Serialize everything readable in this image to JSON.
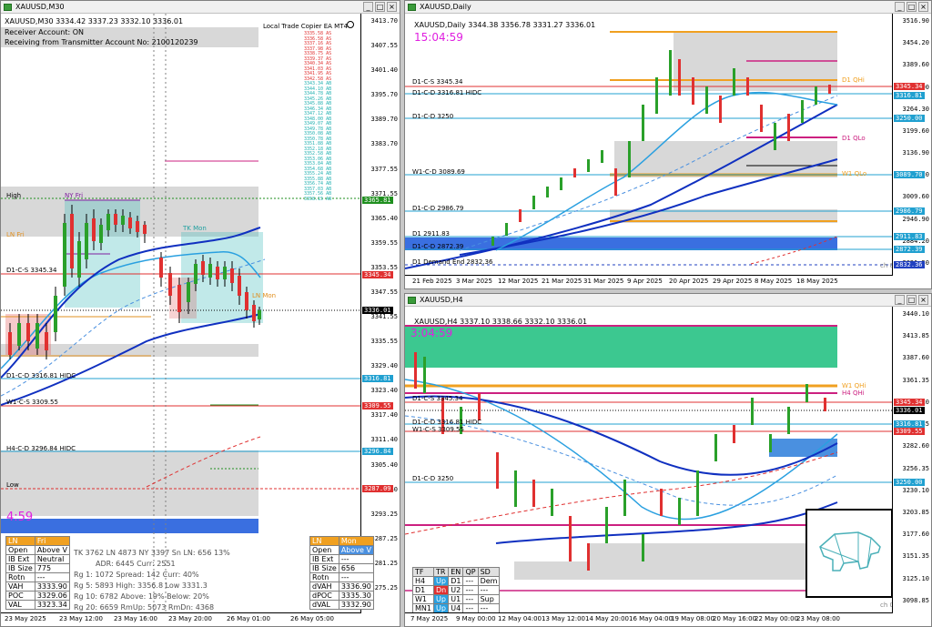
{
  "windows": {
    "m30": {
      "title": "XAUUSD,M30",
      "info_line": "XAUUSD,M30  3334.42 3337.23 3332.10 3336.01",
      "overlay_lines": [
        "Receiver Account: ON",
        "Receiving from Transmitter Account No: 2100120239"
      ],
      "ea_label": "Local Trade Copier EA MT4",
      "timer": "4:59",
      "price_axis": [
        "3413.70",
        "3407.55",
        "3401.40",
        "3395.70",
        "3389.70",
        "3383.70",
        "3377.55",
        "3371.55",
        "3365.40",
        "3359.55",
        "3353.55",
        "3347.55",
        "3341.55",
        "3335.55",
        "3329.40",
        "3323.40",
        "3317.40",
        "3311.40",
        "3305.40",
        "3299.40",
        "3293.25",
        "3287.25",
        "3281.25",
        "3275.25"
      ],
      "price_tags": [
        {
          "text": "3365.81",
          "color": "#1f8f1f"
        },
        {
          "text": "3345.34",
          "color": "#e03030"
        },
        {
          "text": "3336.01",
          "color": "#000000"
        },
        {
          "text": "3316.81",
          "color": "#20a0d0"
        },
        {
          "text": "3309.55",
          "color": "#e03030"
        },
        {
          "text": "3296.84",
          "color": "#20a0d0"
        },
        {
          "text": "3287.09",
          "color": "#e03030"
        }
      ],
      "level_labels": [
        "High",
        "NY Fri",
        "LN Fri",
        "TK Mon",
        "LN Mon",
        "D1-C-S 3345.34",
        "D1-C-D 3316.81 HIDC",
        "W1-C-S 3309.55",
        "H4-C-D 3296.84 HIDC",
        "Low"
      ],
      "time_axis": [
        "23 May 2025",
        "23 May 12:00",
        "23 May 16:00",
        "23 May 20:00",
        "26 May 01:00",
        "26 May 05:00"
      ],
      "ladder": [
        "3335.58",
        "3336.58",
        "3337.16",
        "3337.98",
        "3338.75",
        "3339.37",
        "3340.34",
        "3341.03",
        "3341.95",
        "3342.58",
        "3343.34",
        "3344.10",
        "3344.78",
        "3345.26",
        "3345.88",
        "3346.34",
        "3347.12",
        "3348.00",
        "3349.07",
        "3349.78",
        "3350.08",
        "3350.78",
        "3351.88",
        "3352.18",
        "3352.58",
        "3353.06",
        "3353.84",
        "3354.68",
        "3355.24",
        "3355.88",
        "3356.74",
        "3357.03",
        "3357.56",
        "3358.15"
      ],
      "ladder_tags": [
        "AS",
        "AS",
        "AS",
        "AS",
        "AS",
        "AS",
        "AS",
        "AS",
        "AS",
        "AS",
        "AB",
        "AB",
        "AB",
        "AB",
        "AB",
        "AB",
        "AB",
        "AB",
        "AB",
        "AB",
        "AB",
        "AB",
        "AB",
        "AB",
        "AB",
        "AB",
        "AB",
        "AB",
        "AB",
        "AB",
        "AB",
        "AB",
        "AB",
        "AB"
      ]
    },
    "daily": {
      "title": "XAUUSD,Daily",
      "info_line": "XAUUSD,Daily  3344.38 3356.78 3331.27 3336.01",
      "timer": "15:04:59",
      "price_axis": [
        "3516.90",
        "3454.20",
        "3389.60",
        "3327.00",
        "3264.30",
        "3199.60",
        "3136.90",
        "3074.20",
        "3009.60",
        "2946.90",
        "2884.20",
        "2821.50"
      ],
      "price_tags": [
        {
          "text": "3345.34",
          "color": "#e03030"
        },
        {
          "text": "3316.81",
          "color": "#20a0d0"
        },
        {
          "text": "3250.00",
          "color": "#20a0d0"
        },
        {
          "text": "3089.70",
          "color": "#20a0d0"
        },
        {
          "text": "2986.79",
          "color": "#20a0d0"
        },
        {
          "text": "2911.83",
          "color": "#20a0d0"
        },
        {
          "text": "2872.39",
          "color": "#20a0d0"
        },
        {
          "text": "2832.36",
          "color": "#2040c0"
        }
      ],
      "level_labels": [
        "D1-C-S 3345.34",
        "D1-C-D 3316.81 HIDC",
        "D1-C-D 3250",
        "W1-C-D 3089.69",
        "D1-C-D 2986.79",
        "D1 2911.83",
        "D1-C-D 2872.39",
        "D1 Demand End 2832.36",
        "D1 QHi",
        "D1 QLo",
        "W1 QLo",
        "ch 0"
      ],
      "time_axis": [
        "21 Feb 2025",
        "3 Mar 2025",
        "12 Mar 2025",
        "21 Mar 2025",
        "31 Mar 2025",
        "9 Apr 2025",
        "20 Apr 2025",
        "29 Apr 2025",
        "8 May 2025",
        "18 May 2025"
      ]
    },
    "h4": {
      "title": "XAUUSD,H4",
      "info_line": "XAUUSD,H4  3337.10 3338.66 3332.10 3336.01",
      "timer": "3:04:59",
      "price_axis": [
        "3440.10",
        "3413.85",
        "3387.60",
        "3361.35",
        "3335.10",
        "3308.85",
        "3282.60",
        "3256.35",
        "3230.10",
        "3203.85",
        "3177.60",
        "3151.35",
        "3125.10",
        "3098.85"
      ],
      "price_tags": [
        {
          "text": "3345.34",
          "color": "#e03030"
        },
        {
          "text": "3336.01",
          "color": "#000000"
        },
        {
          "text": "3316.81",
          "color": "#20a0d0"
        },
        {
          "text": "3309.55",
          "color": "#e03030"
        },
        {
          "text": "3250.00",
          "color": "#20a0d0"
        }
      ],
      "level_labels": [
        "W1 QHi",
        "H4 QHi",
        "D1-C-S 3345.34",
        "D1-C-D 3316.81 HIDC",
        "W1-C-S 3309.55",
        "D1-C-D 3250",
        "ch 0"
      ],
      "time_axis": [
        "7 May 2025",
        "9 May 00:00",
        "12 May 04:00",
        "13 May 12:00",
        "14 May 20:00",
        "16 May 04:00",
        "19 May 08:00",
        "20 May 16:00",
        "22 May 00:00",
        "23 May 08:00"
      ],
      "tf_table": {
        "headers": [
          "TF",
          "TR",
          "EN",
          "QP",
          "SD"
        ],
        "rows": [
          [
            "H4",
            "Up",
            "D1",
            "---",
            "Dem"
          ],
          [
            "D1",
            "Dn",
            "U2",
            "---",
            "---"
          ],
          [
            "W1",
            "Up",
            "U1",
            "---",
            "Sup"
          ],
          [
            "MN1",
            "Up",
            "U4",
            "---",
            "---"
          ]
        ]
      }
    }
  },
  "session_panel_left": {
    "header": [
      "LN",
      "Fri"
    ],
    "rows": [
      [
        "Open",
        "Above V"
      ],
      [
        "IB Ext",
        "Neutral"
      ],
      [
        "IB Size",
        "775"
      ],
      [
        "Rotn",
        "---"
      ],
      [
        "VAH",
        "3333.90"
      ],
      [
        "POC",
        "3329.06"
      ],
      [
        "VAL",
        "3323.34"
      ]
    ]
  },
  "session_panel_right": {
    "header": [
      "LN",
      "Mon"
    ],
    "rows": [
      [
        "Open",
        "Above V"
      ],
      [
        "IB Ext",
        "---"
      ],
      [
        "IB Size",
        "656"
      ],
      [
        "Rotn",
        "---"
      ],
      [
        "dVAH",
        "3336.90"
      ],
      [
        "dPOC",
        "3335.30"
      ],
      [
        "dVAL",
        "3332.90"
      ]
    ]
  },
  "stats": {
    "line1": "TK 3762 LN 4873  NY 3397   Sn LN: 656  13%",
    "line2": "ADR:    6445   Curr:   2551",
    "line3": "Rg  1:  1072  Spread: 142     Curr:    40%",
    "line4": "Rg  5:  5893  High:  3356.8   Low    3331.3",
    "line5": "Rg 10:  6782  Above:  19%    Below:  20%",
    "line6": "Rg 20:  6659  RmUp: 5073    RmDn: 4368"
  }
}
